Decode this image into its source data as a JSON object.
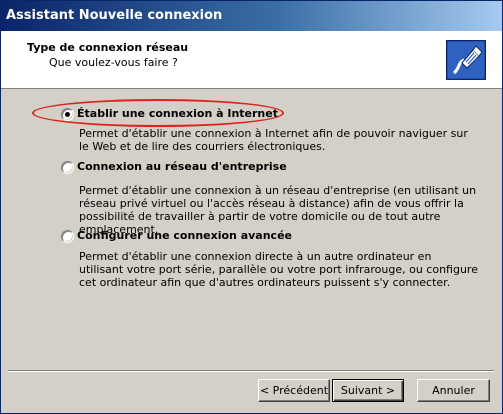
{
  "window": {
    "title": "Assistant Nouvelle connexion"
  },
  "header": {
    "title": "Type de connexion réseau",
    "subtitle": "Que voulez-vous faire ?"
  },
  "options": [
    {
      "label": "Établir une connexion à Internet",
      "selected": true,
      "description": "Permet d'établir une connexion à Internet afin de pouvoir naviguer sur le Web et de lire des courriers électroniques."
    },
    {
      "label": "Connexion au réseau d'entreprise",
      "selected": false,
      "description": "Permet d'établir une connexion à un réseau d'entreprise (en utilisant un réseau privé virtuel ou l'accès réseau à distance) afin de vous offrir la possibilité de travailler à partir de votre domicile ou de tout autre emplacement."
    },
    {
      "label": "Configurer une connexion avancée",
      "selected": false,
      "description": "Permet d'établir une connexion directe à un autre ordinateur en utilisant votre port série, parallèle ou votre port infrarouge, ou configure cet ordinateur afin que d'autres ordinateurs puissent s'y connecter."
    }
  ],
  "buttons": {
    "back": "< Précédent",
    "next": "Suivant >",
    "cancel": "Annuler"
  },
  "colors": {
    "titlebar_start": "#0a246a",
    "titlebar_end": "#a6caf0",
    "annotation": "#e0211d",
    "dialog_bg": "#d4d0c8"
  },
  "icons": {
    "header": "network-cable-plug-icon"
  }
}
